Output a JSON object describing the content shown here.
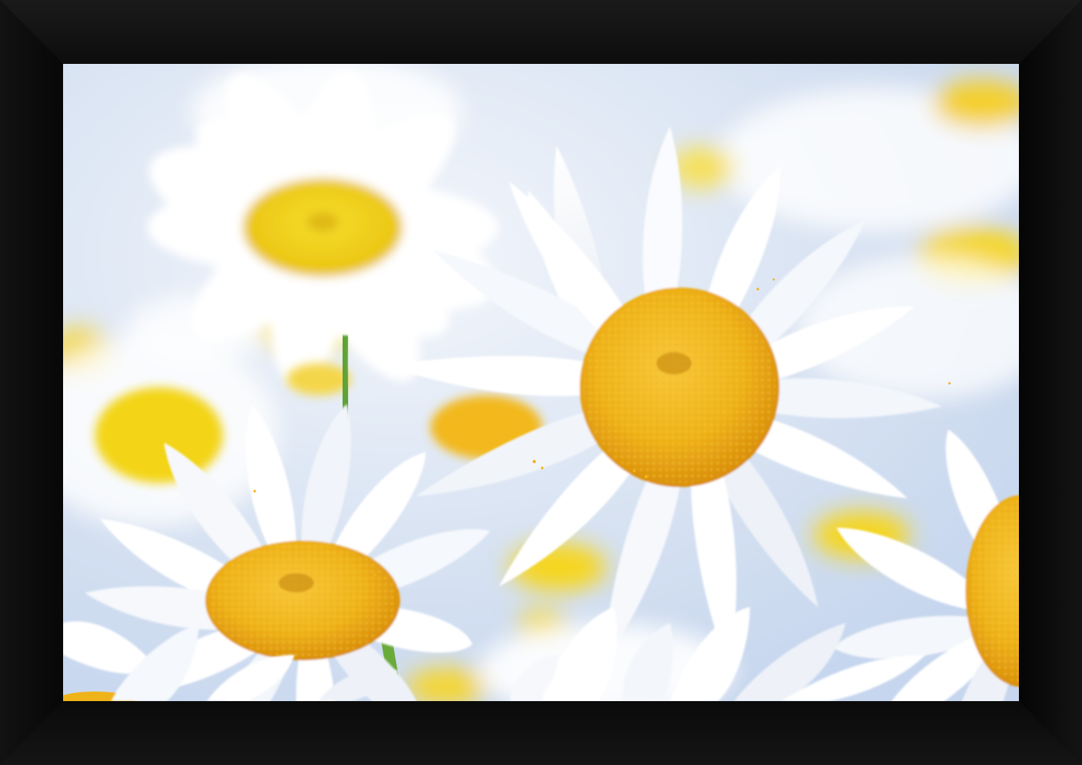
{
  "image": {
    "subject": "daisy-field",
    "colors": {
      "frame": "#0b0b0b",
      "sky": "#cfdcf0",
      "petal": "#ffffff",
      "petal_shade": "#dde4ee",
      "center": "#f2b418",
      "center_dark": "#e09a0a",
      "stem": "#6aaa3a"
    }
  }
}
